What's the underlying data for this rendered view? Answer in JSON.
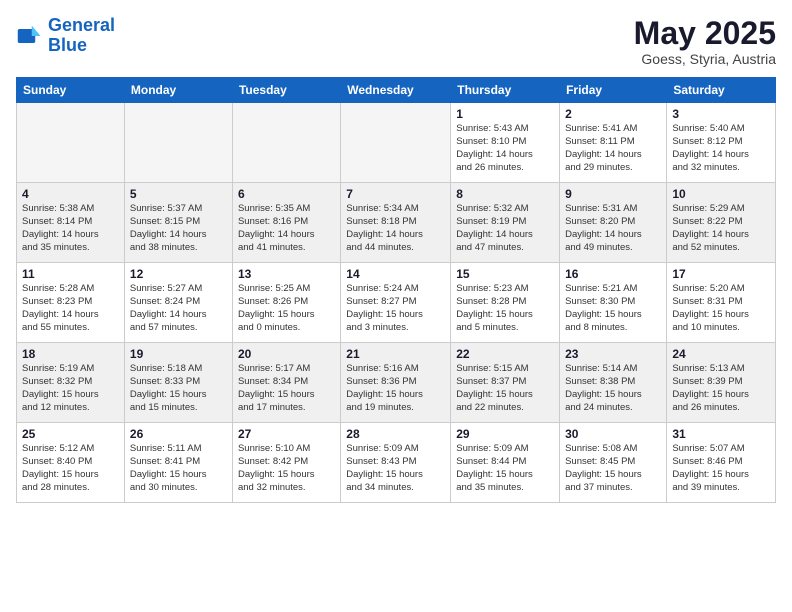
{
  "header": {
    "logo_line1": "General",
    "logo_line2": "Blue",
    "main_title": "May 2025",
    "subtitle": "Goess, Styria, Austria"
  },
  "columns": [
    "Sunday",
    "Monday",
    "Tuesday",
    "Wednesday",
    "Thursday",
    "Friday",
    "Saturday"
  ],
  "weeks": [
    [
      {
        "day": "",
        "info": ""
      },
      {
        "day": "",
        "info": ""
      },
      {
        "day": "",
        "info": ""
      },
      {
        "day": "",
        "info": ""
      },
      {
        "day": "1",
        "info": "Sunrise: 5:43 AM\nSunset: 8:10 PM\nDaylight: 14 hours\nand 26 minutes."
      },
      {
        "day": "2",
        "info": "Sunrise: 5:41 AM\nSunset: 8:11 PM\nDaylight: 14 hours\nand 29 minutes."
      },
      {
        "day": "3",
        "info": "Sunrise: 5:40 AM\nSunset: 8:12 PM\nDaylight: 14 hours\nand 32 minutes."
      }
    ],
    [
      {
        "day": "4",
        "info": "Sunrise: 5:38 AM\nSunset: 8:14 PM\nDaylight: 14 hours\nand 35 minutes."
      },
      {
        "day": "5",
        "info": "Sunrise: 5:37 AM\nSunset: 8:15 PM\nDaylight: 14 hours\nand 38 minutes."
      },
      {
        "day": "6",
        "info": "Sunrise: 5:35 AM\nSunset: 8:16 PM\nDaylight: 14 hours\nand 41 minutes."
      },
      {
        "day": "7",
        "info": "Sunrise: 5:34 AM\nSunset: 8:18 PM\nDaylight: 14 hours\nand 44 minutes."
      },
      {
        "day": "8",
        "info": "Sunrise: 5:32 AM\nSunset: 8:19 PM\nDaylight: 14 hours\nand 47 minutes."
      },
      {
        "day": "9",
        "info": "Sunrise: 5:31 AM\nSunset: 8:20 PM\nDaylight: 14 hours\nand 49 minutes."
      },
      {
        "day": "10",
        "info": "Sunrise: 5:29 AM\nSunset: 8:22 PM\nDaylight: 14 hours\nand 52 minutes."
      }
    ],
    [
      {
        "day": "11",
        "info": "Sunrise: 5:28 AM\nSunset: 8:23 PM\nDaylight: 14 hours\nand 55 minutes."
      },
      {
        "day": "12",
        "info": "Sunrise: 5:27 AM\nSunset: 8:24 PM\nDaylight: 14 hours\nand 57 minutes."
      },
      {
        "day": "13",
        "info": "Sunrise: 5:25 AM\nSunset: 8:26 PM\nDaylight: 15 hours\nand 0 minutes."
      },
      {
        "day": "14",
        "info": "Sunrise: 5:24 AM\nSunset: 8:27 PM\nDaylight: 15 hours\nand 3 minutes."
      },
      {
        "day": "15",
        "info": "Sunrise: 5:23 AM\nSunset: 8:28 PM\nDaylight: 15 hours\nand 5 minutes."
      },
      {
        "day": "16",
        "info": "Sunrise: 5:21 AM\nSunset: 8:30 PM\nDaylight: 15 hours\nand 8 minutes."
      },
      {
        "day": "17",
        "info": "Sunrise: 5:20 AM\nSunset: 8:31 PM\nDaylight: 15 hours\nand 10 minutes."
      }
    ],
    [
      {
        "day": "18",
        "info": "Sunrise: 5:19 AM\nSunset: 8:32 PM\nDaylight: 15 hours\nand 12 minutes."
      },
      {
        "day": "19",
        "info": "Sunrise: 5:18 AM\nSunset: 8:33 PM\nDaylight: 15 hours\nand 15 minutes."
      },
      {
        "day": "20",
        "info": "Sunrise: 5:17 AM\nSunset: 8:34 PM\nDaylight: 15 hours\nand 17 minutes."
      },
      {
        "day": "21",
        "info": "Sunrise: 5:16 AM\nSunset: 8:36 PM\nDaylight: 15 hours\nand 19 minutes."
      },
      {
        "day": "22",
        "info": "Sunrise: 5:15 AM\nSunset: 8:37 PM\nDaylight: 15 hours\nand 22 minutes."
      },
      {
        "day": "23",
        "info": "Sunrise: 5:14 AM\nSunset: 8:38 PM\nDaylight: 15 hours\nand 24 minutes."
      },
      {
        "day": "24",
        "info": "Sunrise: 5:13 AM\nSunset: 8:39 PM\nDaylight: 15 hours\nand 26 minutes."
      }
    ],
    [
      {
        "day": "25",
        "info": "Sunrise: 5:12 AM\nSunset: 8:40 PM\nDaylight: 15 hours\nand 28 minutes."
      },
      {
        "day": "26",
        "info": "Sunrise: 5:11 AM\nSunset: 8:41 PM\nDaylight: 15 hours\nand 30 minutes."
      },
      {
        "day": "27",
        "info": "Sunrise: 5:10 AM\nSunset: 8:42 PM\nDaylight: 15 hours\nand 32 minutes."
      },
      {
        "day": "28",
        "info": "Sunrise: 5:09 AM\nSunset: 8:43 PM\nDaylight: 15 hours\nand 34 minutes."
      },
      {
        "day": "29",
        "info": "Sunrise: 5:09 AM\nSunset: 8:44 PM\nDaylight: 15 hours\nand 35 minutes."
      },
      {
        "day": "30",
        "info": "Sunrise: 5:08 AM\nSunset: 8:45 PM\nDaylight: 15 hours\nand 37 minutes."
      },
      {
        "day": "31",
        "info": "Sunrise: 5:07 AM\nSunset: 8:46 PM\nDaylight: 15 hours\nand 39 minutes."
      }
    ]
  ]
}
